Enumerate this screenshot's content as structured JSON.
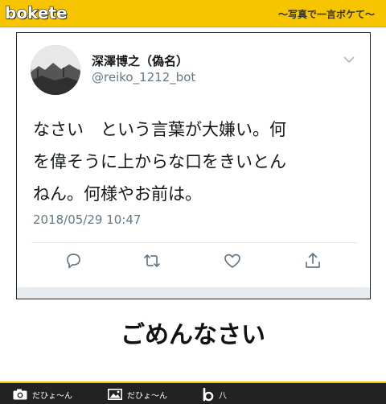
{
  "header": {
    "logo_text": "bokete",
    "tagline": "～写真で一言ボケて～"
  },
  "tweet": {
    "display_name": "深澤博之（偽名）",
    "handle": "@reiko_1212_bot",
    "text": "なさい　という言葉が大嫌い。何\nを偉そうに上からな口をきいとん\nねん。何様やお前は。",
    "timestamp": "2018/05/29 10:47",
    "icons": [
      "reply-icon",
      "retweet-icon",
      "like-icon",
      "share-icon"
    ]
  },
  "caption": "ごめんなさい",
  "footer": {
    "items": [
      {
        "icon": "camera-icon",
        "label": "だひょ～ん"
      },
      {
        "icon": "image-icon",
        "label": "だひょ～ん"
      },
      {
        "icon": "bokete-b-icon",
        "label": "八"
      }
    ]
  },
  "colors": {
    "brand_yellow": "#f7c500",
    "footer_bg": "#222222",
    "twitter_gray": "#657786"
  }
}
